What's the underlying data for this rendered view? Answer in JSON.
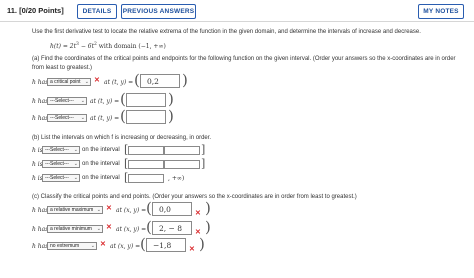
{
  "header": {
    "question_number": "11.",
    "points": "[0/20 Points]",
    "details_label": "DETAILS",
    "previous_answers_label": "PREVIOUS ANSWERS",
    "my_notes_label": "MY NOTES"
  },
  "intro": "Use the first derivative test to locate the relative extrema of the function in the given domain, and determine the intervals of increase and decrease.",
  "function": {
    "lhs": "h(t) = 2t",
    "exp1": "3",
    "mid": " − 6t",
    "exp2": "2",
    "domain": " with domain (−1, +∞)"
  },
  "part_a": {
    "instruction": "(a) Find the coordinates of the critical points and endpoints for the following function on the given interval. (Order your answers so the x-coordinates are in order from least to greatest.)",
    "rows": [
      {
        "prefix": "h has",
        "select_value": "a critical point",
        "at_label": "at (t, y) =",
        "answer": "0,2",
        "has_x": true
      },
      {
        "prefix": "h has",
        "select_value": "---Select---",
        "at_label": "at (t, y) =",
        "answer": "",
        "has_x": false
      },
      {
        "prefix": "h has",
        "select_value": "---Select---",
        "at_label": "at (t, y) =",
        "answer": "",
        "has_x": false
      }
    ]
  },
  "part_b": {
    "instruction": "(b) List the intervals on which f is increasing or decreasing, in order.",
    "rows": [
      {
        "prefix": "h is",
        "select_value": "---Select---",
        "label": "on the interval",
        "right": ""
      },
      {
        "prefix": "h is",
        "select_value": "---Select---",
        "label": "on the interval",
        "right": ""
      },
      {
        "prefix": "h is",
        "select_value": "---Select---",
        "label": "on the interval",
        "right": "+∞"
      }
    ]
  },
  "part_c": {
    "instruction": "(c) Classify the critical points and end points. (Order your answers so the x-coordinates are in order from least to greatest.)",
    "rows": [
      {
        "prefix": "h has",
        "select_value": "a relative maximum",
        "at_label": "at (x, y) =",
        "answer": "0,0",
        "has_x": true
      },
      {
        "prefix": "h has",
        "select_value": "a relative minimum",
        "at_label": "at (x, y) =",
        "answer": "2, − 8",
        "has_x": true
      },
      {
        "prefix": "h has",
        "select_value": "no extremum",
        "at_label": "at (x, y) =",
        "answer": "−1,8",
        "has_x": true
      }
    ]
  },
  "icons": {
    "wrong": "x-mark-icon",
    "dropdown": "chevron-down-icon"
  },
  "colors": {
    "accent": "#2a5db0",
    "error": "#d9262a",
    "border": "#8a8a8a"
  }
}
